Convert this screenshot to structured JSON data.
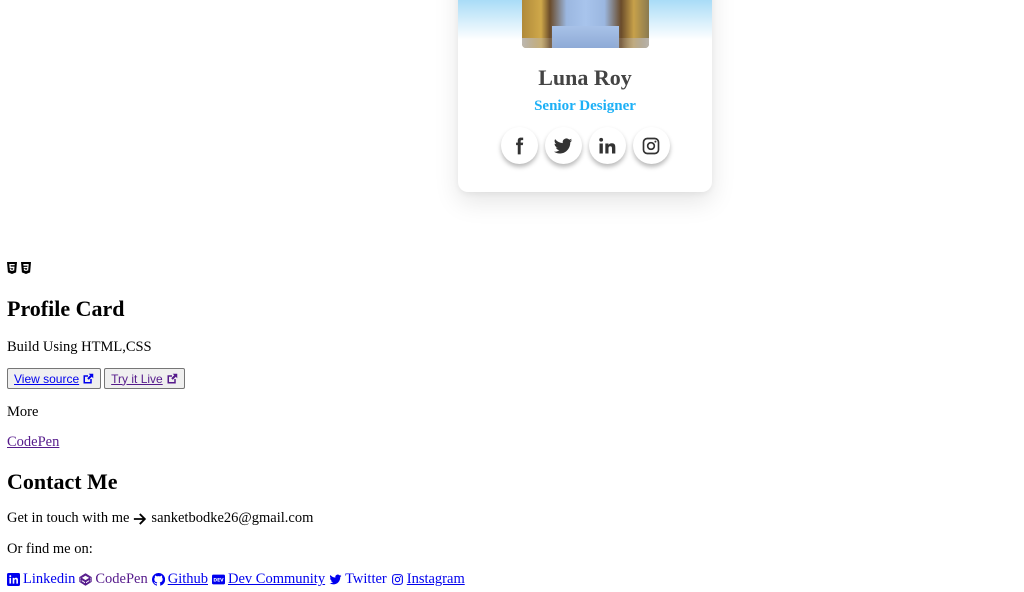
{
  "card": {
    "name": "Luna Roy",
    "role": "Senior Designer",
    "role_color": "#1cb0f6",
    "socials": [
      {
        "icon": "facebook-icon"
      },
      {
        "icon": "twitter-icon"
      },
      {
        "icon": "linkedin-icon"
      },
      {
        "icon": "instagram-icon"
      }
    ]
  },
  "info": {
    "tech_icons": [
      "html5-icon",
      "css3-icon"
    ],
    "title": "Profile Card",
    "subtitle": "Build Using HTML,CSS",
    "buttons": {
      "view_source": "View source",
      "try_live": "Try it Live"
    },
    "more_label": "More",
    "more_link": "CodePen"
  },
  "contact": {
    "title": "Contact Me",
    "touch_text": "Get in touch with me",
    "email": "sanketbodke26@gmail.com",
    "find_text": "Or find me on:",
    "links": [
      {
        "label": "Linkedin",
        "icon": "linkedin-icon"
      },
      {
        "label": "CodePen",
        "icon": "codepen-icon"
      },
      {
        "label": "Github",
        "icon": "github-icon"
      },
      {
        "label": "Dev Community",
        "icon": "dev-icon"
      },
      {
        "label": "Twitter",
        "icon": "twitter-icon"
      },
      {
        "label": "Instagram",
        "icon": "instagram-icon"
      }
    ]
  }
}
